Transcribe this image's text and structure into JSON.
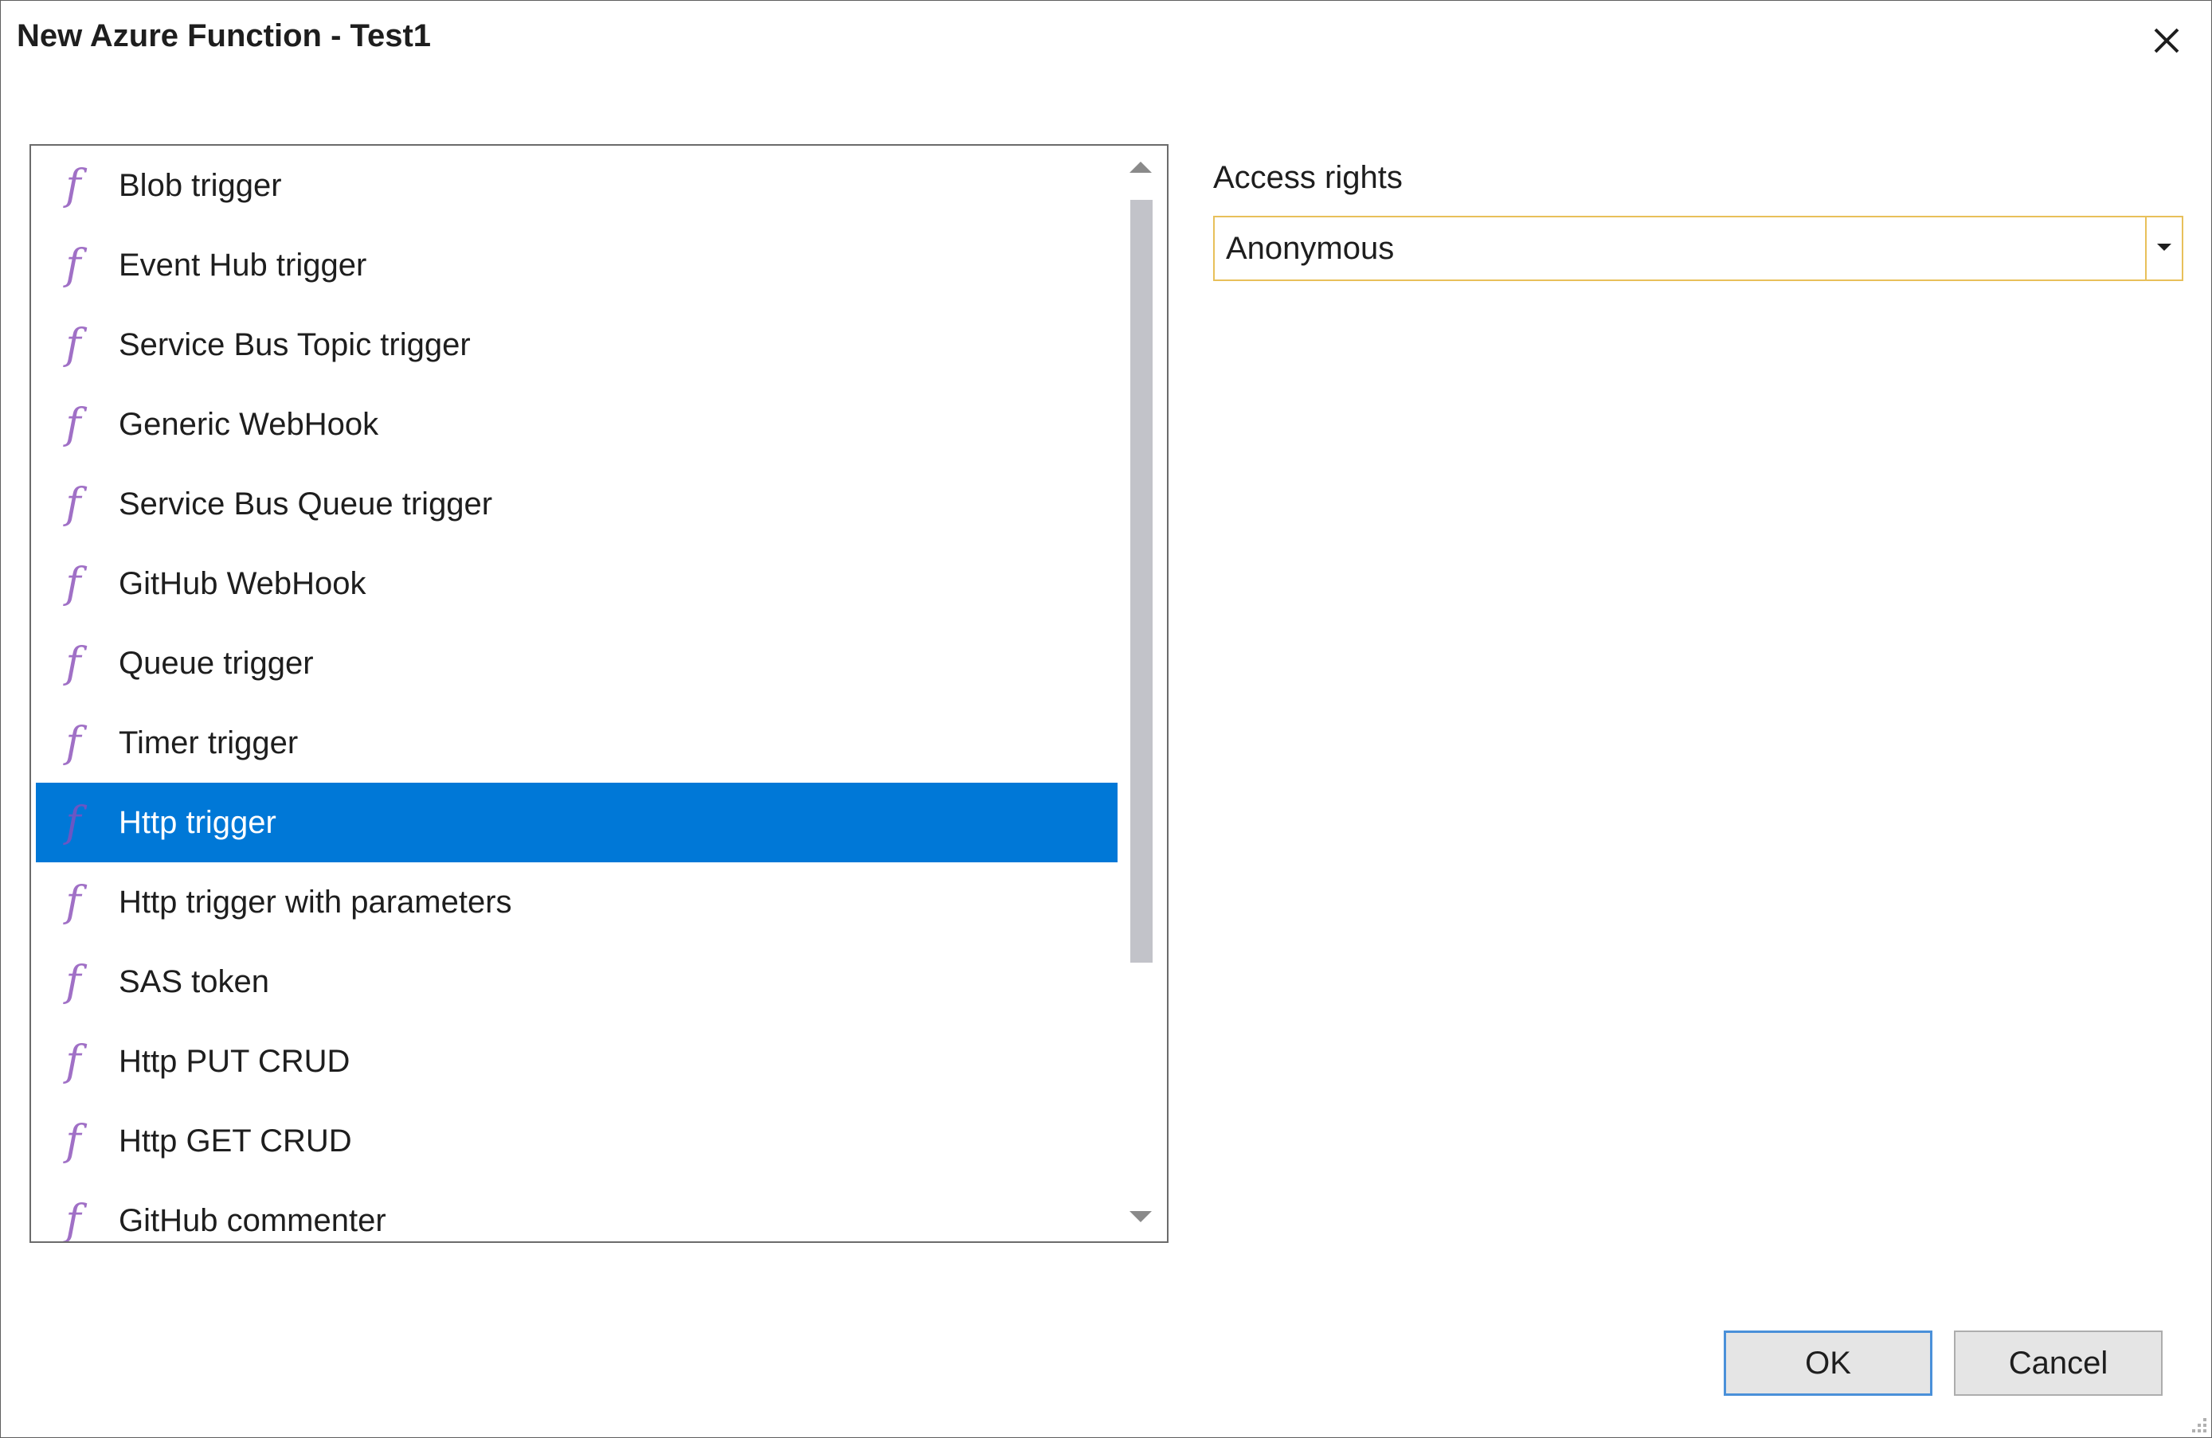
{
  "window": {
    "title": "New Azure Function - Test1",
    "close_icon": "close-icon"
  },
  "templates": {
    "items": [
      {
        "label": "Blob trigger",
        "icon": "function-icon"
      },
      {
        "label": "Event Hub trigger",
        "icon": "function-icon"
      },
      {
        "label": "Service Bus Topic trigger",
        "icon": "function-icon"
      },
      {
        "label": "Generic WebHook",
        "icon": "function-icon"
      },
      {
        "label": "Service Bus Queue trigger",
        "icon": "function-icon"
      },
      {
        "label": "GitHub WebHook",
        "icon": "function-icon"
      },
      {
        "label": "Queue trigger",
        "icon": "function-icon"
      },
      {
        "label": "Timer trigger",
        "icon": "function-icon"
      },
      {
        "label": "Http trigger",
        "icon": "function-icon",
        "selected": true
      },
      {
        "label": "Http trigger with parameters",
        "icon": "function-icon"
      },
      {
        "label": "SAS token",
        "icon": "function-icon"
      },
      {
        "label": "Http PUT CRUD",
        "icon": "function-icon"
      },
      {
        "label": "Http GET CRUD",
        "icon": "function-icon"
      },
      {
        "label": "GitHub commenter",
        "icon": "function-icon"
      }
    ],
    "icon_glyph": "f"
  },
  "access_rights": {
    "label": "Access rights",
    "selected": "Anonymous"
  },
  "buttons": {
    "ok": "OK",
    "cancel": "Cancel"
  },
  "colors": {
    "selection": "#0078d7",
    "function_icon": "#a070c6",
    "combo_border": "#e8c05a",
    "ok_border": "#4a90d9"
  }
}
